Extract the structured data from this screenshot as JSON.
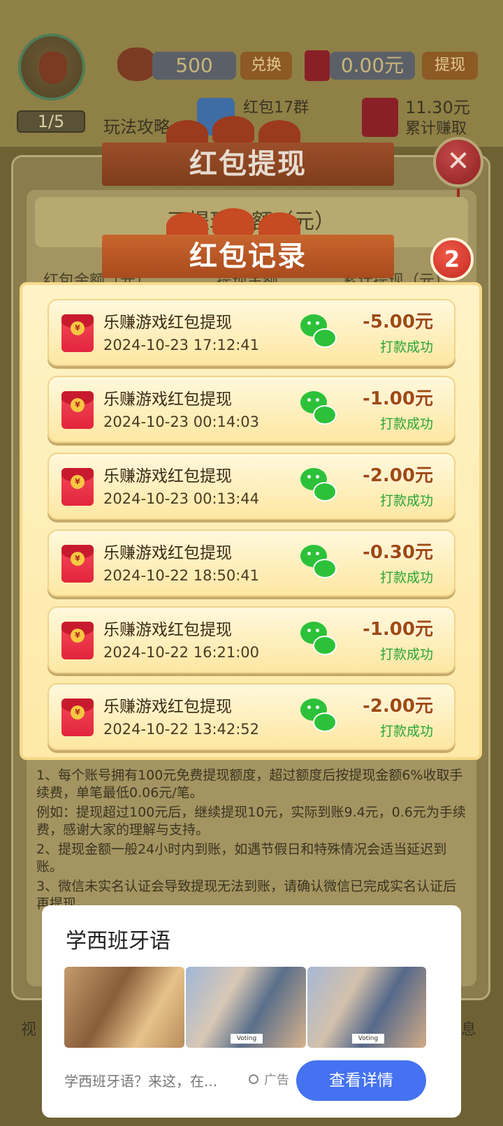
{
  "hud": {
    "level": "1/5",
    "coins": "500",
    "exchange_label": "兑换",
    "cash": "0.00元",
    "withdraw_label": "提现",
    "guide_label": "玩法攻略",
    "group_label": "红包17群",
    "earned_amount": "11.30元",
    "earned_label": "累计赚取"
  },
  "back_dialog": {
    "title": "红包提现",
    "amount_title": "可提现金额（元）",
    "col_1": "红包金额（元）",
    "col_2": "提现金额",
    "col_3": "累计提现（元）",
    "rules": [
      "1、每个账号拥有100元免费提现额度，超过额度后按提现金额6%收取手续费，单笔最低0.06元/笔。",
      "例如：提现超过100元后，继续提现10元，实际到账9.4元，0.6元为手续费，感谢大家的理解与支持。",
      "2、提现金额一般24小时内到账，如遇节假日和特殊情况会适当延迟到账。",
      "3、微信未实名认证会导致提现无法到账，请确认微信已完成实名认证后再提现。"
    ],
    "close_symbol": "✕"
  },
  "records_panel": {
    "title": "红包记录",
    "badge": "2",
    "records": [
      {
        "title": "乐赚游戏红包提现",
        "time": "2024-10-23 17:12:41",
        "amount": "-5.00元",
        "status": "打款成功"
      },
      {
        "title": "乐赚游戏红包提现",
        "time": "2024-10-23 00:14:03",
        "amount": "-1.00元",
        "status": "打款成功"
      },
      {
        "title": "乐赚游戏红包提现",
        "time": "2024-10-23 00:13:44",
        "amount": "-2.00元",
        "status": "打款成功"
      },
      {
        "title": "乐赚游戏红包提现",
        "time": "2024-10-22 18:50:41",
        "amount": "-0.30元",
        "status": "打款成功"
      },
      {
        "title": "乐赚游戏红包提现",
        "time": "2024-10-22 16:21:00",
        "amount": "-1.00元",
        "status": "打款成功"
      },
      {
        "title": "乐赚游戏红包提现",
        "time": "2024-10-22 13:42:52",
        "amount": "-2.00元",
        "status": "打款成功"
      }
    ]
  },
  "ad": {
    "title": "学西班牙语",
    "description": "学西班牙语？来这，在...",
    "tag": "广告",
    "button": "查看详情",
    "sign_text": "Voting"
  },
  "bottom": {
    "left_text": "视",
    "right_text": "息"
  },
  "colors": {
    "accent_green": "#2aa534",
    "amount_orange": "#a04a10",
    "ad_button_blue": "#4472f0"
  }
}
